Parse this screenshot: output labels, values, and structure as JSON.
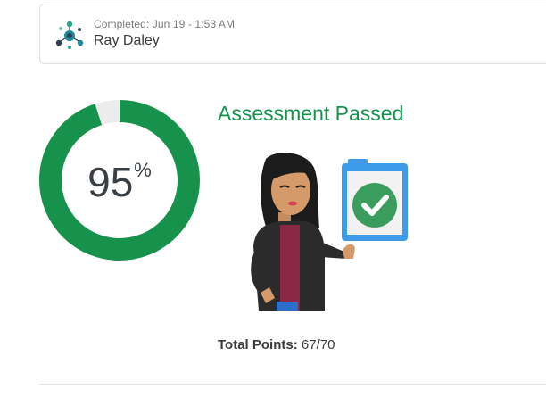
{
  "header": {
    "completed_text": "Completed: Jun 19 - 1:53 AM",
    "user_name": "Ray Daley",
    "app_icon": "network-nodes-icon"
  },
  "result": {
    "score_value": "95",
    "score_unit": "%",
    "score_fraction": 0.95,
    "title": "Assessment Passed",
    "points_label": "Total Points:",
    "points_value": "67/70",
    "illustration": "woman-pointing-to-checklist-illustration"
  },
  "colors": {
    "accent": "#16924d",
    "ring_track": "#ececec",
    "clipboard": "#3e9bea",
    "check": "#3a9d5d"
  }
}
